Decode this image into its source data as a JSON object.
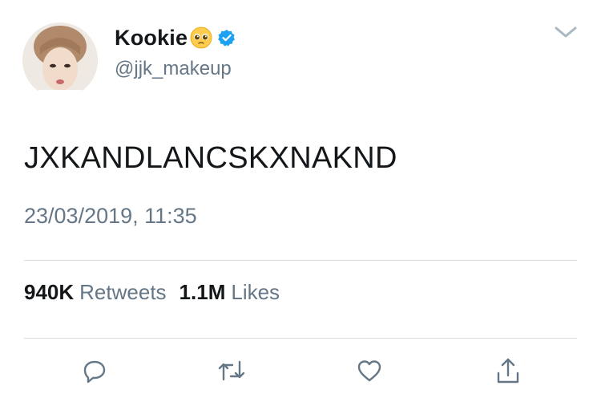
{
  "user": {
    "display_name": "Kookie",
    "handle": "@jjk_makeup",
    "name_emoji": "pleading-face-emoji",
    "verified_icon": "verified-badge-icon"
  },
  "tweet": {
    "text": "JXKANDLANCSKXNAKND",
    "timestamp": "23/03/2019, 11:35"
  },
  "stats": {
    "retweets_count": "940K",
    "retweets_label": "Retweets",
    "likes_count": "1.1M",
    "likes_label": "Likes"
  },
  "actions": {
    "reply_icon": "reply-icon",
    "retweet_icon": "retweet-icon",
    "like_icon": "heart-icon",
    "share_icon": "share-icon"
  },
  "colors": {
    "primary_text": "#14171a",
    "secondary_text": "#657786",
    "verified_blue": "#1da1f2",
    "divider": "#d7dde2"
  }
}
